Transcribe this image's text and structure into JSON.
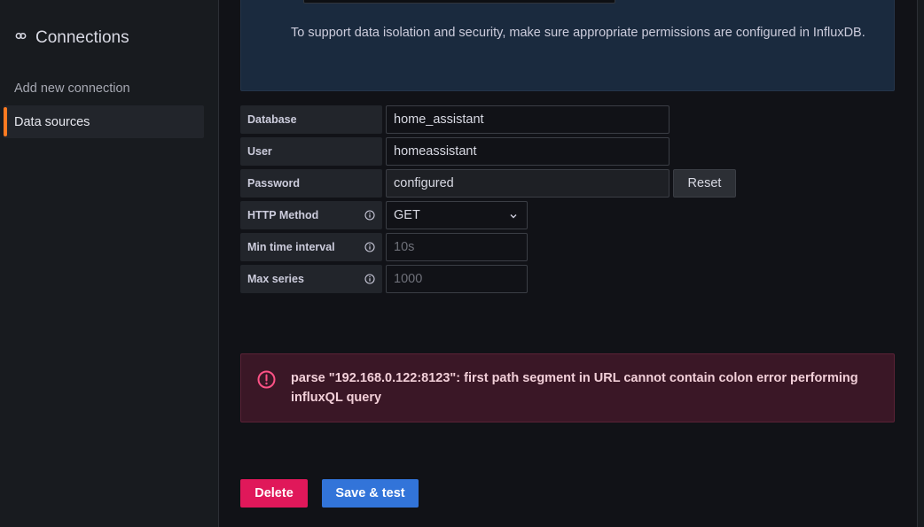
{
  "sidebar": {
    "title": "Connections",
    "items": [
      {
        "label": "Add new connection",
        "active": false
      },
      {
        "label": "Data sources",
        "active": true
      }
    ]
  },
  "info": {
    "text": "To support data isolation and security, make sure appropriate permissions are configured in InfluxDB."
  },
  "fields": {
    "database": {
      "label": "Database",
      "value": "home_assistant"
    },
    "user": {
      "label": "User",
      "value": "homeassistant"
    },
    "password": {
      "label": "Password",
      "value": "configured",
      "reset_label": "Reset"
    },
    "http_method": {
      "label": "HTTP Method",
      "value": "GET"
    },
    "min_time_interval": {
      "label": "Min time interval",
      "placeholder": "10s"
    },
    "max_series": {
      "label": "Max series",
      "placeholder": "1000"
    }
  },
  "error": {
    "message": "parse \"192.168.0.122:8123\": first path segment in URL cannot contain colon error performing influxQL query"
  },
  "actions": {
    "delete_label": "Delete",
    "save_label": "Save & test"
  },
  "colors": {
    "accent_orange": "#ff7a21",
    "delete_red": "#e0185a",
    "save_blue": "#3274d9",
    "error_pink": "#ff5286"
  }
}
